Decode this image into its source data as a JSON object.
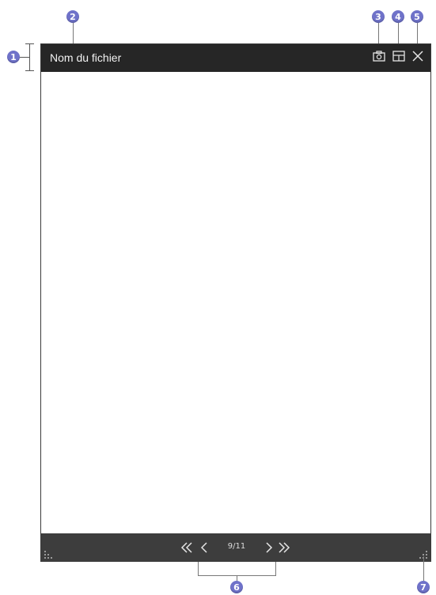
{
  "window": {
    "title": "Nom du fichier",
    "page_indicator": "9/11"
  },
  "callouts": [
    "1",
    "2",
    "3",
    "4",
    "5",
    "6",
    "7"
  ],
  "toolbar_icons": [
    "camera-icon",
    "layout-icon",
    "close-icon"
  ],
  "nav_icons": [
    "first-page-icon",
    "previous-page-icon",
    "next-page-icon",
    "last-page-icon"
  ],
  "colors": {
    "titlebar": "#262626",
    "bottombar": "#3d3d3d",
    "callout": "#6f72c9"
  }
}
